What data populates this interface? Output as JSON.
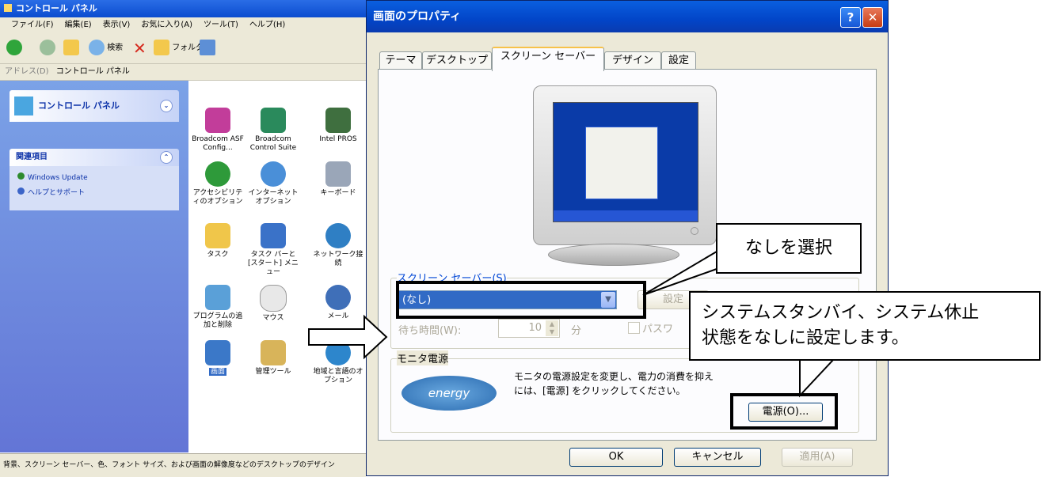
{
  "control_panel": {
    "title": "コントロール パネル",
    "menu": [
      "ファイル(F)",
      "編集(E)",
      "表示(V)",
      "お気に入り(A)",
      "ツール(T)",
      "ヘルプ(H)"
    ],
    "toolbar": {
      "search": "検索",
      "folders": "フォルダ"
    },
    "address_label": "アドレス(D)",
    "address_value": "コントロール パネル",
    "sidebar": {
      "panel_title": "コントロール パネル",
      "related_title": "関連項目",
      "related_links": [
        "Windows Update",
        "ヘルプとサポート"
      ]
    },
    "items": [
      "Broadcom ASF Config...",
      "Broadcom Control Suite",
      "Intel PROS",
      "アクセシビリティのオプション",
      "インターネット オプション",
      "キーボード",
      "タスク",
      "タスク バーと [スタート] メニュー",
      "ネットワーク接続",
      "プログラムの追加と削除",
      "マウス",
      "メール",
      "画面",
      "管理ツール",
      "地域と言語のオプション"
    ],
    "status": "背景、スクリーン セーバー、色、フォント サイズ、および画面の解像度などのデスクトップのデザイン"
  },
  "dialog": {
    "title": "画面のプロパティ",
    "help_glyph": "?",
    "close_glyph": "✕",
    "tabs": [
      "テーマ",
      "デスクトップ",
      "スクリーン セーバー",
      "デザイン",
      "設定"
    ],
    "active_tab": "スクリーン セーバー",
    "screensaver_label": "スクリーン セーバー(S)",
    "screensaver_value": "(なし)",
    "settings_btn": "設定",
    "wait_label": "待ち時間(W):",
    "wait_value": "10",
    "wait_unit": "分",
    "password_label": "パスワ",
    "monitor_power_label": "モニタ電源",
    "monitor_power_text_line1": "モニタの電源設定を変更し、電力の消費を抑え",
    "monitor_power_text_line2": "には、[電源] をクリックしてください。",
    "power_btn": "電源(O)...",
    "energy_logo": "energy",
    "ok_btn": "OK",
    "cancel_btn": "キャンセル",
    "apply_btn": "適用(A)"
  },
  "callouts": {
    "select_none": "なしを選択",
    "standby_line1": "システムスタンバイ、システム休止",
    "standby_line2": "状態をなしに設定します。"
  }
}
